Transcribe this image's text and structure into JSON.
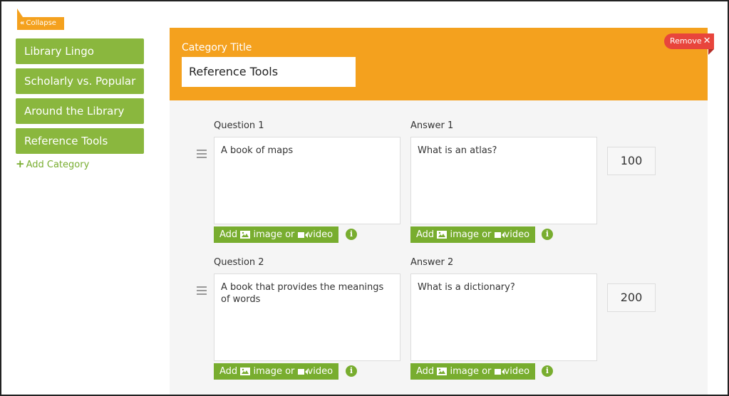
{
  "sidebar": {
    "collapse_label": "Collapse",
    "categories": [
      {
        "label": "Library Lingo"
      },
      {
        "label": "Scholarly vs. Popular"
      },
      {
        "label": "Around the Library"
      },
      {
        "label": "Reference Tools"
      }
    ],
    "add_category_label": "Add Category"
  },
  "category": {
    "title_label": "Category Title",
    "title_value": "Reference Tools",
    "remove_label": "Remove"
  },
  "questions": [
    {
      "question_label": "Question 1",
      "question_text": "A book of maps",
      "answer_label": "Answer 1",
      "answer_text": "What is an atlas?",
      "points": "100"
    },
    {
      "question_label": "Question 2",
      "question_text": "A book that provides the meanings of words",
      "answer_label": "Answer 2",
      "answer_text": "What is a dictionary?",
      "points": "200"
    }
  ],
  "media_button": {
    "add": "Add",
    "image": "image or",
    "video": "video"
  },
  "colors": {
    "orange": "#f4a11e",
    "green": "#8ab73e",
    "green_dark": "#78ad2f",
    "red": "#e8453c"
  }
}
